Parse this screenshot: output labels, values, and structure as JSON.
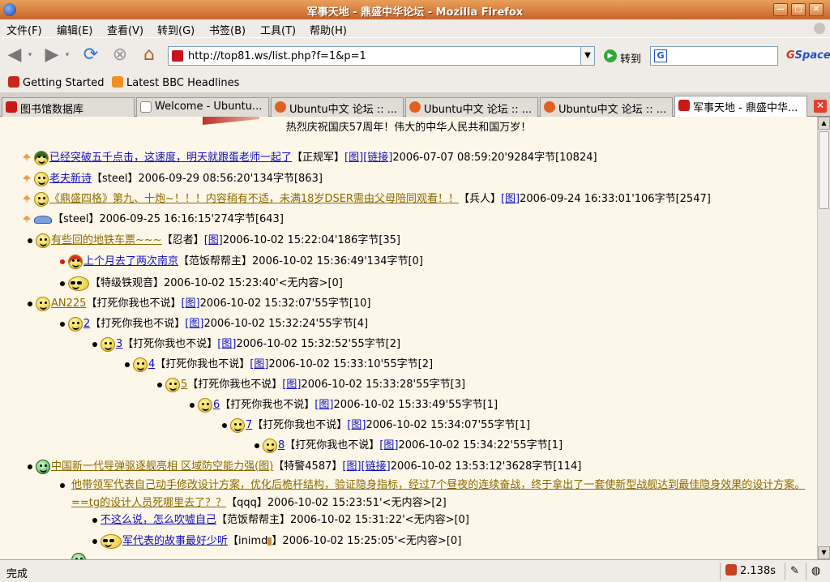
{
  "window": {
    "title": "军事天地 - 鼎盛中华论坛 - Mozilla Firefox"
  },
  "menu": {
    "items": [
      "文件(F)",
      "编辑(E)",
      "查看(V)",
      "转到(G)",
      "书签(B)",
      "工具(T)",
      "帮助(H)"
    ]
  },
  "toolbar": {
    "url": "http://top81.ws/list.php?f=1&p=1",
    "go_label": "转到",
    "search_placeholder": "",
    "gspace_a": "G",
    "gspace_b": "Space"
  },
  "bookmarks": [
    {
      "label": "Getting Started"
    },
    {
      "label": "Latest BBC Headlines"
    }
  ],
  "tabs": [
    {
      "label": "图书馆数据库"
    },
    {
      "label": "Welcome - Ubuntu..."
    },
    {
      "label": "Ubuntu中文 论坛 :: ..."
    },
    {
      "label": "Ubuntu中文 论坛 :: ..."
    },
    {
      "label": "Ubuntu中文 论坛 :: ..."
    },
    {
      "label": "军事天地 - 鼎盛中华..."
    }
  ],
  "page": {
    "banner": "热烈庆祝国庆57周年！伟大的中华人民共和国万岁！",
    "posts": [
      {
        "title": "已经突破五千点击，这速度，明天就跟蛋老师一起了",
        "meta": "【正规军】",
        "l1": "[图]",
        "l2": "[链接]",
        "info": "2006-07-07 08:59:20'9284字节[10824]"
      },
      {
        "title": "老夫新诗",
        "meta": "【steel】",
        "info": "2006-09-29 08:56:20'134字节[863]"
      },
      {
        "title": "《鼎盛四格》第九、十炮~！！！内容稍有不适，未满18岁DSER需由父母陪同观看！！",
        "meta": "【兵人】",
        "l1": "[图]",
        "info": "2006-09-24 16:33:01'106字节[2547]"
      },
      {
        "title": "",
        "meta": "【steel】",
        "info": "2006-09-25 16:16:15'274字节[643]"
      },
      {
        "title": "有些回的地铁车票~~~",
        "meta": "【忍者】",
        "l1": "[图]",
        "info": "2006-10-02 15:22:04'186字节[35]"
      },
      {
        "title": "上个月去了两次南京",
        "meta": "【范饭帮帮主】",
        "info": "2006-10-02 15:36:49'134字节[0]"
      },
      {
        "title": "",
        "meta": "【特级铁观音】",
        "info": "2006-10-02 15:23:40'<无内容>[0]"
      },
      {
        "title": "AN225",
        "meta": "【打死你我也不说】",
        "l1": "[图]",
        "info": "2006-10-02 15:32:07'55字节[10]"
      },
      {
        "title": "2",
        "meta": "【打死你我也不说】",
        "l1": "[图]",
        "info": "2006-10-02 15:32:24'55字节[4]"
      },
      {
        "title": "3",
        "meta": "【打死你我也不说】",
        "l1": "[图]",
        "info": "2006-10-02 15:32:52'55字节[2]"
      },
      {
        "title": "4",
        "meta": "【打死你我也不说】",
        "l1": "[图]",
        "info": "2006-10-02 15:33:10'55字节[2]"
      },
      {
        "title": "5",
        "meta": "【打死你我也不说】",
        "l1": "[图]",
        "info": "2006-10-02 15:33:28'55字节[3]"
      },
      {
        "title": "6",
        "meta": "【打死你我也不说】",
        "l1": "[图]",
        "info": "2006-10-02 15:33:49'55字节[1]"
      },
      {
        "title": "7",
        "meta": "【打死你我也不说】",
        "l1": "[图]",
        "info": "2006-10-02 15:34:07'55字节[1]"
      },
      {
        "title": "8",
        "meta": "【打死你我也不说】",
        "l1": "[图]",
        "info": "2006-10-02 15:34:22'55字节[1]"
      },
      {
        "title": "中国新一代导弹驱逐舰亮相 区域防空能力强(图)",
        "meta": "【特警4587】",
        "l1": "[图]",
        "l2": "[链接]",
        "info": "2006-10-02 13:53:12'3628字节[114]"
      },
      {
        "title": "他带领军代表自己动手修改设计方案，优化后桅杆结构，验证隐身指标，经过7个昼夜的连续奋战，终于拿出了一套使新型战舰达到最佳隐身效果的设计方案。==tg的设计人员死哪里去了？？",
        "meta": "【qqq】",
        "info": "2006-10-02 15:23:51'<无内容>[2]"
      },
      {
        "title": "不这么说，怎么吹嘘自己",
        "meta": "【范饭帮帮主】",
        "info": "2006-10-02 15:31:22'<无内容>[0]"
      },
      {
        "title": "军代表的故事最好少听",
        "meta": "【inimd",
        "meta2": "】",
        "info": "2006-10-02 15:25:05'<无内容>[0]"
      }
    ]
  },
  "status": {
    "text": "完成",
    "timing": "2.138s"
  }
}
